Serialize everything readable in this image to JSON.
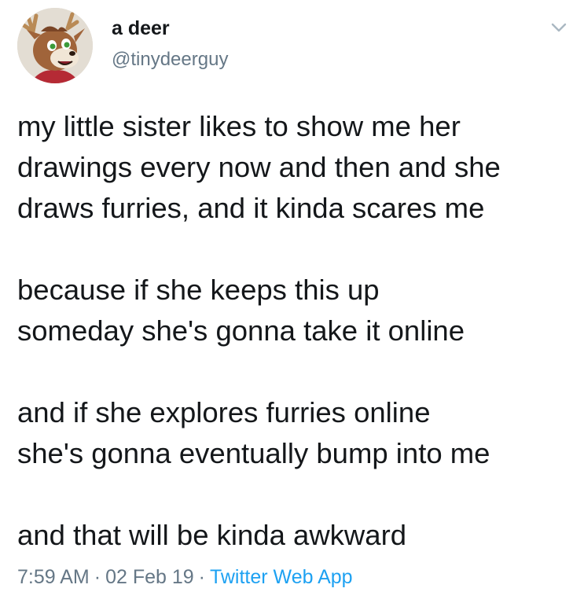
{
  "tweet": {
    "author": {
      "display_name": "a deer",
      "handle": "@tinydeerguy",
      "avatar_icon": "deer-fursona-avatar"
    },
    "menu_icon": "chevron-down-icon",
    "paragraphs": [
      "my little sister likes to show me her\ndrawings every now and then and she\ndraws furries, and it kinda scares me",
      "because if she keeps this up\nsomeday she's gonna take it online",
      "and if she explores furries online\nshe's gonna eventually bump into me",
      "and that will be kinda awkward"
    ],
    "meta": {
      "time": "7:59 AM",
      "separator": "·",
      "date": "02 Feb 19",
      "source": "Twitter Web App"
    }
  },
  "colors": {
    "text_primary": "#14171a",
    "text_secondary": "#657786",
    "link": "#1da1f2"
  }
}
